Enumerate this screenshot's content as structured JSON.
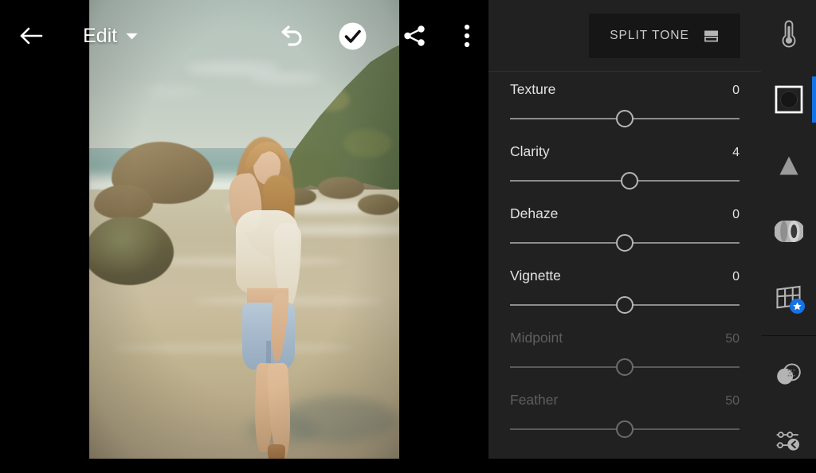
{
  "app": {
    "screen_title": "Edit",
    "accent_color": "#1473e6",
    "panel_bg": "#212121",
    "canvas_bg": "#000000"
  },
  "topbar": {
    "back_label": "back-arrow",
    "title": "Edit",
    "title_chevron": "chevron-down",
    "undo_label": "undo",
    "done_label": "done",
    "share_label": "share",
    "more_label": "more-options"
  },
  "panel": {
    "section_button": {
      "label": "SPLIT TONE",
      "icon": "split-tone-icon"
    },
    "sliders": [
      {
        "label": "Texture",
        "value": "0",
        "position": 50.0,
        "disabled": false
      },
      {
        "label": "Clarity",
        "value": "4",
        "position": 52.0,
        "disabled": false
      },
      {
        "label": "Dehaze",
        "value": "0",
        "position": 50.0,
        "disabled": false
      },
      {
        "label": "Vignette",
        "value": "0",
        "position": 50.0,
        "disabled": false
      },
      {
        "label": "Midpoint",
        "value": "50",
        "position": 50.0,
        "disabled": true
      },
      {
        "label": "Feather",
        "value": "50",
        "position": 50.0,
        "disabled": true
      }
    ]
  },
  "rail": {
    "items": [
      {
        "name": "color-icon",
        "active": false,
        "badge": false
      },
      {
        "name": "effects-icon",
        "active": true,
        "badge": false
      },
      {
        "name": "detail-icon",
        "active": false,
        "badge": false
      },
      {
        "name": "optics-icon",
        "active": false,
        "badge": false
      },
      {
        "name": "geometry-icon",
        "active": false,
        "badge": true
      },
      {
        "name": "healing-icon",
        "active": false,
        "badge": false
      },
      {
        "name": "presets-icon",
        "active": false,
        "badge": false
      }
    ]
  },
  "photo": {
    "description": "Beach scene: woman standing in shallow surf, rocks, forested headland"
  }
}
